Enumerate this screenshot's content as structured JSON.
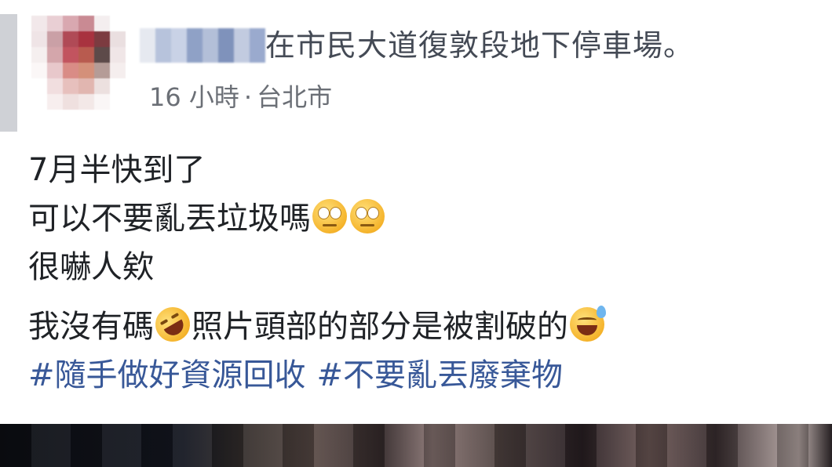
{
  "header": {
    "text": "在市民大道復敦段地下停車場。",
    "time": "16 小時",
    "separator": "·",
    "location": "台北市"
  },
  "post": {
    "line1": "7月半快到了",
    "line2": "可以不要亂丟垃圾嗎",
    "line3": "很嚇人欸",
    "line4a": "我沒有碼",
    "line4b": "照片頭部的部分是被割破的",
    "hashtags": [
      "#隨手做好資源回收",
      "#不要亂丟廢棄物"
    ]
  },
  "icons": {
    "eyeroll": "face-with-rolling-eyes-icon",
    "rofl": "rolling-on-floor-laughing-icon",
    "sweat": "grinning-face-with-sweat-icon"
  },
  "colors": {
    "hashtag": "#385898",
    "meta": "#6b6f76",
    "text": "#1f2226"
  }
}
